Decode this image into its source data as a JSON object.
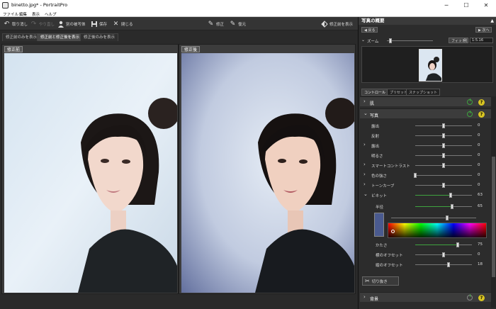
{
  "window": {
    "title": "binetto.jpg* - PortraitPro",
    "minimize": "─",
    "maximize": "☐",
    "close": "✕"
  },
  "menu": {
    "file": "ファイル",
    "edit": "編集",
    "view": "表示",
    "help": "ヘルプ"
  },
  "toolbar": {
    "undo": "取り消し",
    "redo": "やり直し",
    "other_subject": "別の被写体",
    "save": "保存",
    "close": "閉じる",
    "modify": "修正",
    "restore": "復元",
    "before_modify": "修正前を表示"
  },
  "view_tabs": [
    "修正前のみを表示",
    "修正前と修正後を表示",
    "修正後のみを表示"
  ],
  "panes": {
    "before_label": "修正前",
    "after_label": "修正後"
  },
  "overview": {
    "title": "写真の概要",
    "back": "戻る",
    "next": "次へ",
    "zoom_label": "ズーム",
    "zoom_level": 0.05,
    "fit_label": "フィット",
    "ratio_label": "例",
    "ratio_value": "1:5.16"
  },
  "controls": {
    "tabs": [
      "コントロール",
      "プリセット",
      "スナップショット"
    ],
    "groups": [
      {
        "label": "肌",
        "expanded": false
      },
      {
        "label": "写真",
        "expanded": true
      },
      {
        "label": "背景",
        "expanded": false
      }
    ],
    "sliders": [
      {
        "label": "露出",
        "value": "0",
        "level": 0.5,
        "chevron": false
      },
      {
        "label": "反射",
        "value": "0",
        "level": 0.5,
        "chevron": false
      },
      {
        "label": "露出",
        "value": "0",
        "level": 0.5,
        "chevron": true
      },
      {
        "label": "明るさ",
        "value": "0",
        "level": 0.5,
        "chevron": false
      },
      {
        "label": "スマートコントラスト",
        "value": "0",
        "level": 0.5,
        "chevron": true
      },
      {
        "label": "色の強さ",
        "value": "0",
        "level": 0.0,
        "chevron": true
      },
      {
        "label": "トーンカーブ",
        "value": "0",
        "level": 0.5,
        "chevron": true
      },
      {
        "label": "ビネット",
        "value": "63",
        "level": 0.63,
        "chevron": true,
        "open": true
      }
    ],
    "vignette": {
      "radius_label": "半径",
      "radius_value": "65",
      "radius_level": 0.65,
      "hardness_label": "かたさ",
      "hardness_value": "75",
      "hardness_level": 0.75,
      "h_offset_label": "横のオフセット",
      "h_offset_value": "0",
      "h_offset_level": 0.5,
      "v_offset_label": "縦のオフセット",
      "v_offset_value": "18",
      "v_offset_level": 0.59,
      "swatch_color": "#4a5a8f"
    },
    "cut_button": "切り抜き"
  },
  "colors": {
    "accent_green": "#3fa33f",
    "help_yellow": "#d8c422"
  }
}
